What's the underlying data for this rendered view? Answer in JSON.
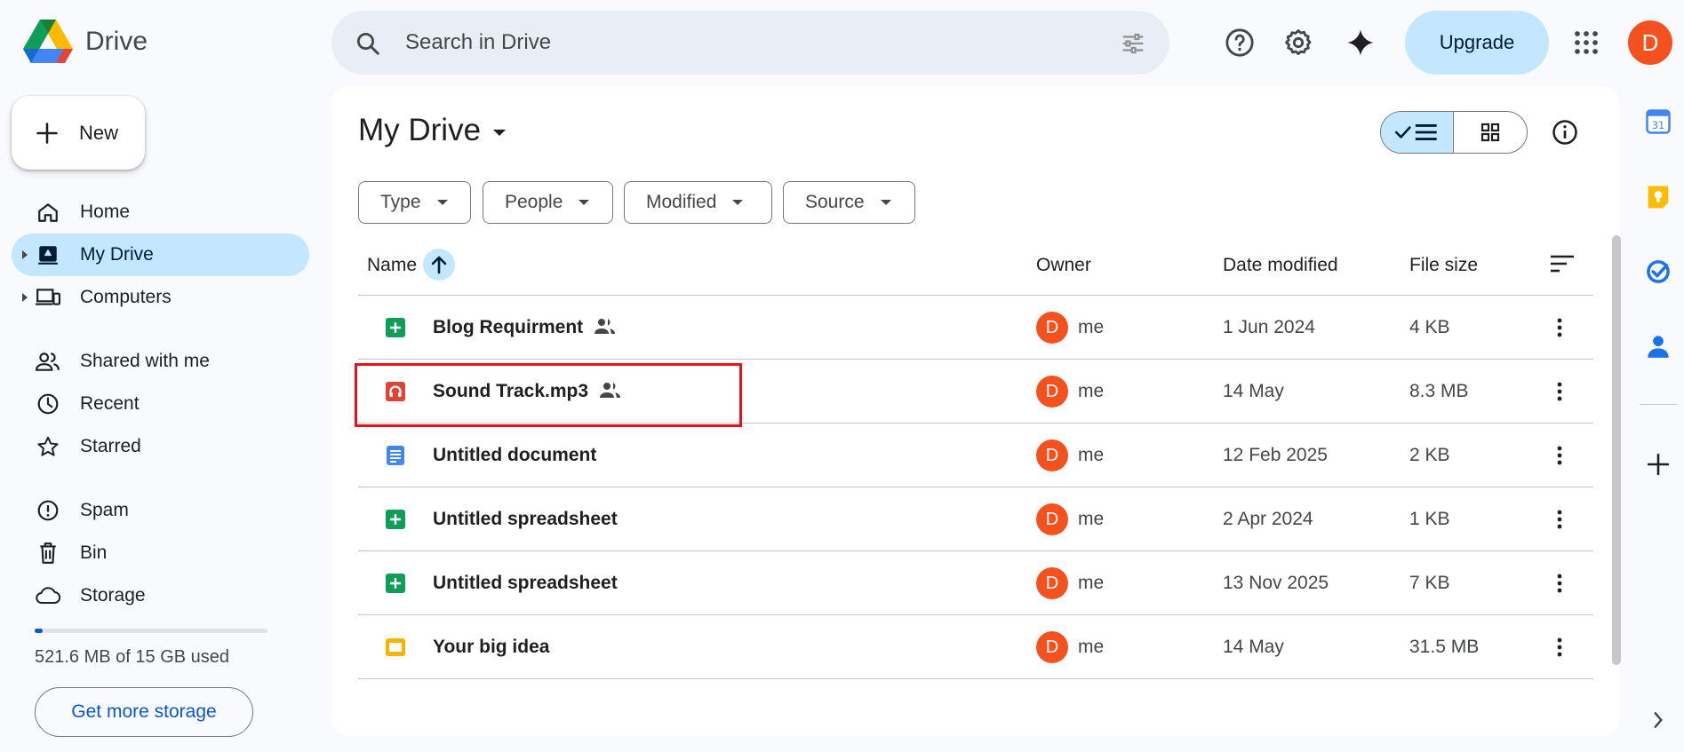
{
  "app": {
    "name": "Drive",
    "search_placeholder": "Search in Drive",
    "upgrade_label": "Upgrade",
    "user_initial": "D"
  },
  "sidebar": {
    "new_label": "New",
    "items": [
      {
        "label": "Home",
        "icon": "home-icon"
      },
      {
        "label": "My Drive",
        "icon": "my-drive-icon",
        "active": true
      },
      {
        "label": "Computers",
        "icon": "computers-icon"
      },
      {
        "label": "Shared with me",
        "icon": "shared-with-me-icon"
      },
      {
        "label": "Recent",
        "icon": "recent-clock-icon"
      },
      {
        "label": "Starred",
        "icon": "star-icon"
      },
      {
        "label": "Spam",
        "icon": "spam-icon"
      },
      {
        "label": "Bin",
        "icon": "bin-icon"
      },
      {
        "label": "Storage",
        "icon": "cloud-icon"
      }
    ],
    "storage_used_fraction": 0.034,
    "storage_text": "521.6 MB of 15 GB used",
    "get_more_storage_label": "Get more storage"
  },
  "main": {
    "title": "My Drive",
    "filters": [
      "Type",
      "People",
      "Modified",
      "Source"
    ],
    "columns": {
      "name": "Name",
      "owner": "Owner",
      "date_modified": "Date modified",
      "file_size": "File size"
    },
    "files": [
      {
        "name": "Blog Requirment",
        "type": "sheets",
        "shared": true,
        "owner_initial": "D",
        "owner": "me",
        "modified": "1 Jun 2024",
        "size": "4 KB"
      },
      {
        "name": "Sound Track.mp3",
        "type": "audio",
        "shared": true,
        "owner_initial": "D",
        "owner": "me",
        "modified": "14 May",
        "size": "8.3 MB"
      },
      {
        "name": "Untitled document",
        "type": "docs",
        "shared": false,
        "owner_initial": "D",
        "owner": "me",
        "modified": "12 Feb 2025",
        "size": "2 KB"
      },
      {
        "name": "Untitled spreadsheet",
        "type": "sheets",
        "shared": false,
        "owner_initial": "D",
        "owner": "me",
        "modified": "2 Apr 2024",
        "size": "1 KB"
      },
      {
        "name": "Untitled spreadsheet",
        "type": "sheets",
        "shared": false,
        "owner_initial": "D",
        "owner": "me",
        "modified": "13 Nov 2025",
        "size": "7 KB"
      },
      {
        "name": "Your big idea",
        "type": "slides",
        "shared": false,
        "owner_initial": "D",
        "owner": "me",
        "modified": "14 May",
        "size": "31.5 MB"
      }
    ]
  },
  "colors": {
    "accent": "#0b57d0",
    "selected_bg": "#c2e7ff",
    "avatar": "#f4511e",
    "highlight_box": "#e8101c",
    "sheets": "#0f9d58",
    "audio": "#db4437",
    "docs": "#4285f4",
    "slides": "#f4b400"
  }
}
